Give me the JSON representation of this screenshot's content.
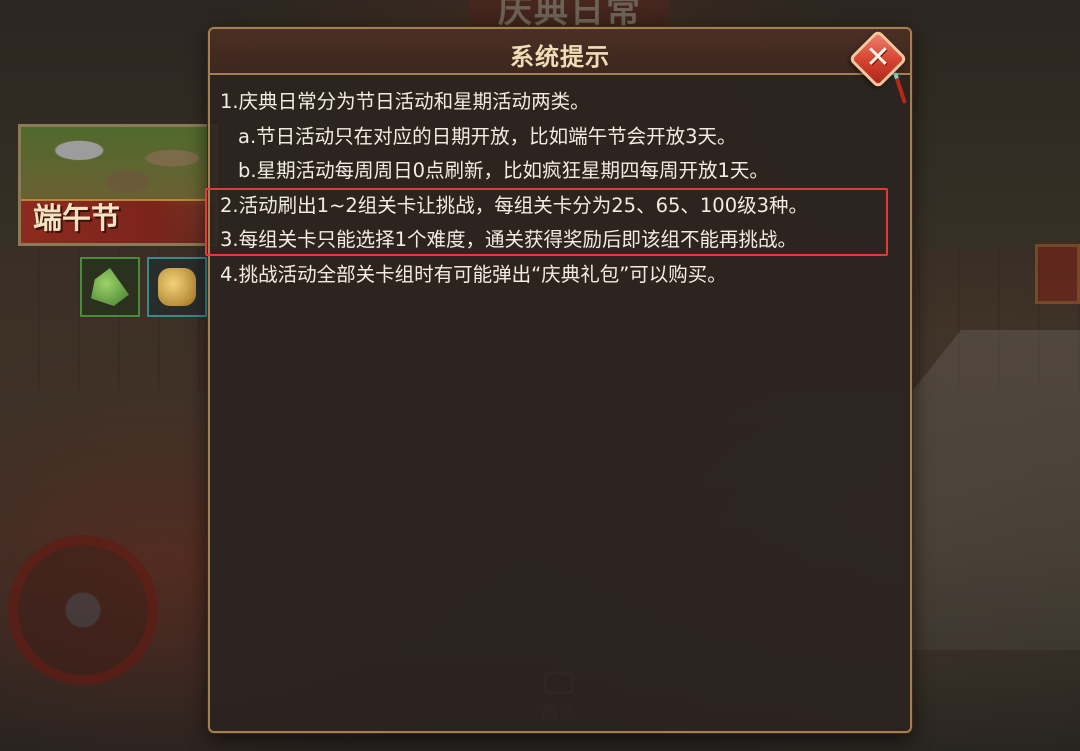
{
  "background": {
    "game_title": "庆典日常",
    "event_card": {
      "label": "端午节"
    },
    "rewards": [
      {
        "icon": "zongzi-icon"
      },
      {
        "icon": "gold-ingot-icon"
      }
    ],
    "shop_label": "商店"
  },
  "dialog": {
    "title": "系统提示",
    "close_icon": "close-icon",
    "lines": [
      "1.庆典日常分为节日活动和星期活动两类。",
      "a.节日活动只在对应的日期开放，比如端午节会开放3天。",
      "b.星期活动每周周日0点刷新，比如疯狂星期四每周开放1天。",
      "2.活动刷出1~2组关卡让挑战，每组关卡分为25、65、100级3种。",
      "3.每组关卡只能选择1个难度，通关获得奖励后即该组不能再挑战。",
      "4.挑战活动全部关卡组时有可能弹出“庆典礼包”可以购买。"
    ],
    "highlight_color": "#e23a3a"
  }
}
